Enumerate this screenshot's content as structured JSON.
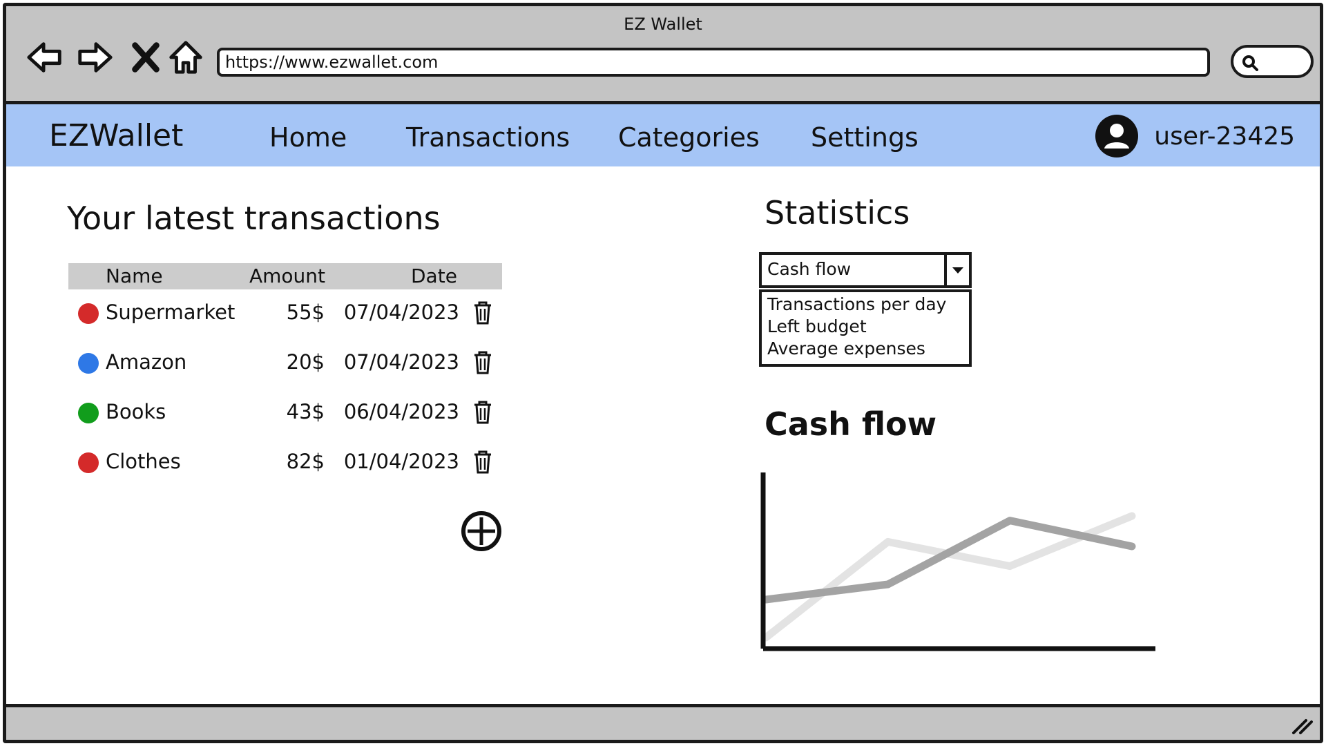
{
  "browser": {
    "title": "EZ Wallet",
    "url": "https://www.ezwallet.com",
    "icons": [
      "back-arrow-icon",
      "forward-arrow-icon",
      "close-x-icon",
      "home-icon",
      "search-icon"
    ]
  },
  "app": {
    "brand": "EZWallet",
    "nav": [
      "Home",
      "Transactions",
      "Categories",
      "Settings"
    ],
    "user": "user-23425",
    "colors": {
      "navbar": "#a5c5f6",
      "chrome": "#c4c4c4"
    }
  },
  "transactions": {
    "title": "Your latest transactions",
    "columns": [
      "Name",
      "Amount",
      "Date"
    ],
    "rows": [
      {
        "name": "Supermarket",
        "amount": "55$",
        "date": "07/04/2023",
        "color": "#d42a2a"
      },
      {
        "name": "Amazon",
        "amount": "20$",
        "date": "07/04/2023",
        "color": "#2e78e6"
      },
      {
        "name": "Books",
        "amount": "43$",
        "date": "06/04/2023",
        "color": "#119d1c"
      },
      {
        "name": "Clothes",
        "amount": "82$",
        "date": "01/04/2023",
        "color": "#d42a2a"
      }
    ]
  },
  "statistics": {
    "title": "Statistics",
    "selected": "Cash flow",
    "options": [
      "Transactions per day",
      "Left budget",
      "Average expenses"
    ]
  },
  "chart_data": {
    "type": "line",
    "title": "Cash flow",
    "xlabel": "",
    "ylabel": "",
    "grid": false,
    "x": [
      0,
      1,
      2,
      3
    ],
    "ylim": [
      0,
      10
    ],
    "series": [
      {
        "values": [
          3,
          4,
          8.2,
          6.5
        ],
        "color": "#a3a3a3"
      },
      {
        "values": [
          0.5,
          6.8,
          5.2,
          8.5
        ],
        "color": "#e3e3e3"
      }
    ]
  }
}
